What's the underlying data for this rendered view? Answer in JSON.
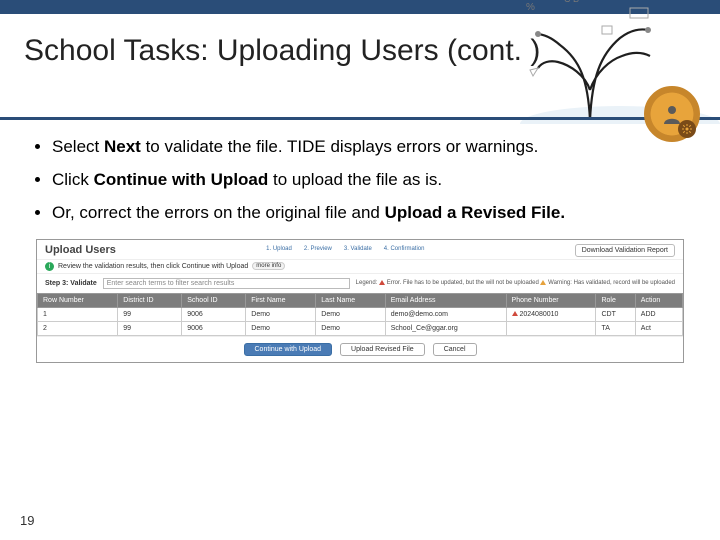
{
  "slide": {
    "title": "School Tasks: Uploading Users (cont. )",
    "page_number": "19"
  },
  "bullets": [
    {
      "pre": "Select ",
      "b": "Next",
      "post": " to validate the file. TIDE displays errors or warnings."
    },
    {
      "pre": "Click ",
      "b": "Continue with Upload",
      "post": " to upload the file as is."
    },
    {
      "pre": "Or, correct the errors on the original file and ",
      "b": "Upload a Revised File.",
      "post": ""
    }
  ],
  "screenshot": {
    "panel_title": "Upload Users",
    "steps": [
      "1. Upload",
      "2. Preview",
      "3. Validate",
      "4. Confirmation"
    ],
    "download_btn": "Download Validation Report",
    "review_text": "Review the validation results, then click Continue with Upload",
    "review_pill": "more info",
    "step_label": "Step 3: Validate",
    "filter_placeholder": "Enter search terms to filter search results",
    "legend_label": "Legend:",
    "legend_error": "Error. File has to be updated, but the will not be uploaded",
    "legend_warning": "Warning: Has validated, record will be uploaded",
    "columns": [
      "Row Number",
      "District ID",
      "School ID",
      "First Name",
      "Last Name",
      "Email Address",
      "Phone Number",
      "Role",
      "Action"
    ],
    "rows": [
      {
        "num": "1",
        "district": "99",
        "school": "9006",
        "first": "Demo",
        "last": "Demo",
        "email": "demo@demo.com",
        "phone": "2024080010",
        "role": "CDT",
        "action": "ADD",
        "err": true
      },
      {
        "num": "2",
        "district": "99",
        "school": "9006",
        "first": "Demo",
        "last": "Demo",
        "email": "School_Ce@ggar.org",
        "phone": "",
        "role": "TA",
        "action": "Act",
        "err": false
      }
    ],
    "buttons": {
      "continue": "Continue with Upload",
      "revised": "Upload Revised File",
      "cancel": "Cancel"
    }
  }
}
